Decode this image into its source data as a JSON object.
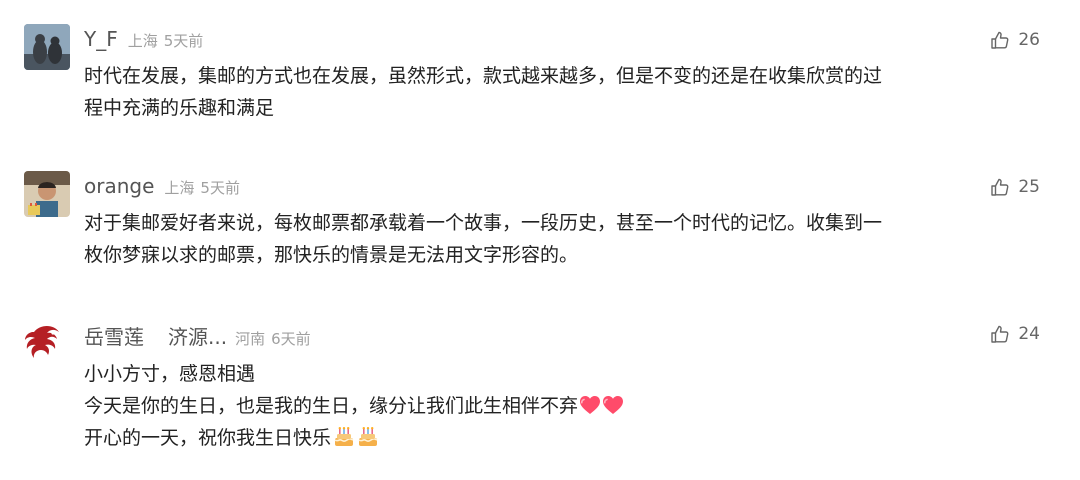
{
  "comments": [
    {
      "user": "Y_F",
      "location": "上海",
      "time": "5天前",
      "likes": "26",
      "lines": [
        "时代在发展，集邮的方式也在发展，虽然形式，款式越来越多，但是不变的还是在收集欣赏的过",
        "程中充满的乐趣和满足"
      ]
    },
    {
      "user": "orange",
      "location": "上海",
      "time": "5天前",
      "likes": "25",
      "lines": [
        "对于集邮爱好者来说，每枚邮票都承载着一个故事，一段历史，甚至一个时代的记忆。收集到一",
        "枚你梦寐以求的邮票，那快乐的情景是无法用文字形容的。"
      ]
    },
    {
      "user": "岳雪莲",
      "source": "济源...",
      "location": "河南",
      "time": "6天前",
      "likes": "24",
      "lines": [
        "小小方寸，感恩相遇",
        "今天是你的生日，也是我的生日，缘分让我们此生相伴不弃",
        "开心的一天，祝你我生日快乐"
      ]
    }
  ],
  "icons": {
    "like": "thumbs-up-outline-icon",
    "heart": "heart-emoji-icon",
    "cake": "birthday-cake-emoji-icon"
  },
  "colors": {
    "heart": "#ff4b6a",
    "cake": "#f5b04a"
  }
}
